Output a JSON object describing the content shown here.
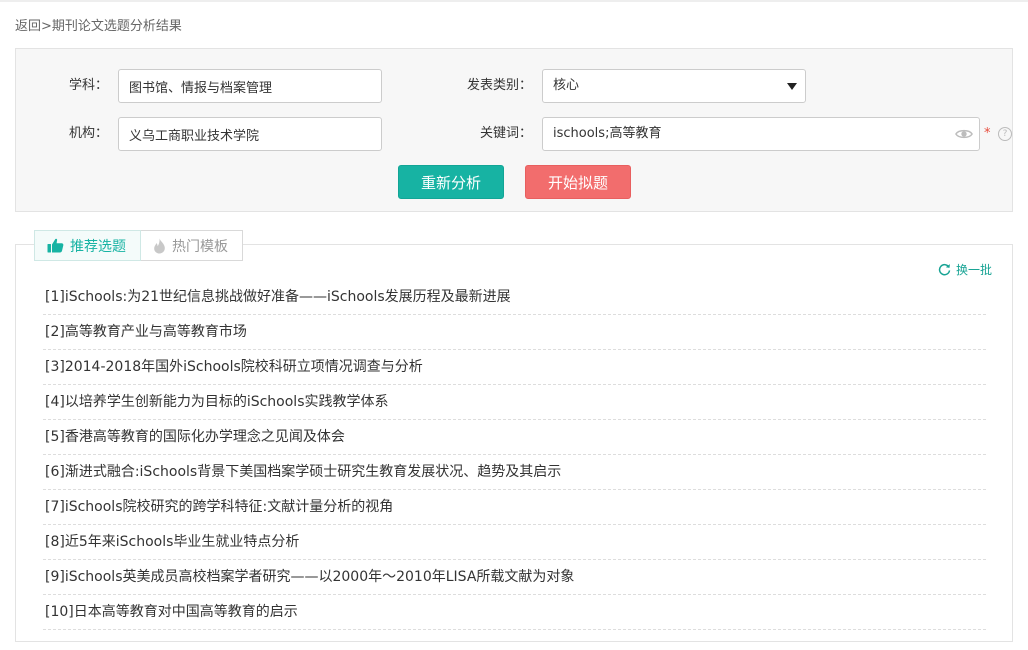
{
  "breadcrumb": {
    "back": "返回",
    "separator": ">",
    "current": "期刊论文选题分析结果"
  },
  "form": {
    "subject": {
      "label": "学科：",
      "value": "图书馆、情报与档案管理"
    },
    "institution": {
      "label": "机构：",
      "value": "义乌工商职业技术学院"
    },
    "category": {
      "label": "发表类别：",
      "value": "核心"
    },
    "keywords": {
      "label": "关键词：",
      "value": "ischools;高等教育",
      "required_mark": "*",
      "help_mark": "?"
    },
    "reanalyze_label": "重新分析",
    "start_label": "开始拟题"
  },
  "tabs": {
    "recommended": {
      "label": "推荐选题"
    },
    "hot_templates": {
      "label": "热门模板"
    }
  },
  "refresh_label": "换一批",
  "results": [
    "[1]iSchools:为21世纪信息挑战做好准备——iSchools发展历程及最新进展",
    "[2]高等教育产业与高等教育市场",
    "[3]2014-2018年国外iSchools院校科研立项情况调查与分析",
    "[4]以培养学生创新能力为目标的iSchools实践教学体系",
    "[5]香港高等教育的国际化办学理念之见闻及体会",
    "[6]渐进式融合:iSchools背景下美国档案学硕士研究生教育发展状况、趋势及其启示",
    "[7]iSchools院校研究的跨学科特征:文献计量分析的视角",
    "[8]近5年来iSchools毕业生就业特点分析",
    "[9]iSchools英美成员高校档案学者研究——以2000年～2010年LISA所载文献为对象",
    "[10]日本高等教育对中国高等教育的启示"
  ],
  "colors": {
    "accent": "#17b3a3",
    "danger": "#f26d6d",
    "required": "#e74c3c"
  },
  "icons": {
    "eye": "eye-icon",
    "dropdown": "caret-down-icon",
    "tab_recommended": "thumbs-up-icon",
    "tab_hot": "flame-icon",
    "refresh": "refresh-icon"
  }
}
